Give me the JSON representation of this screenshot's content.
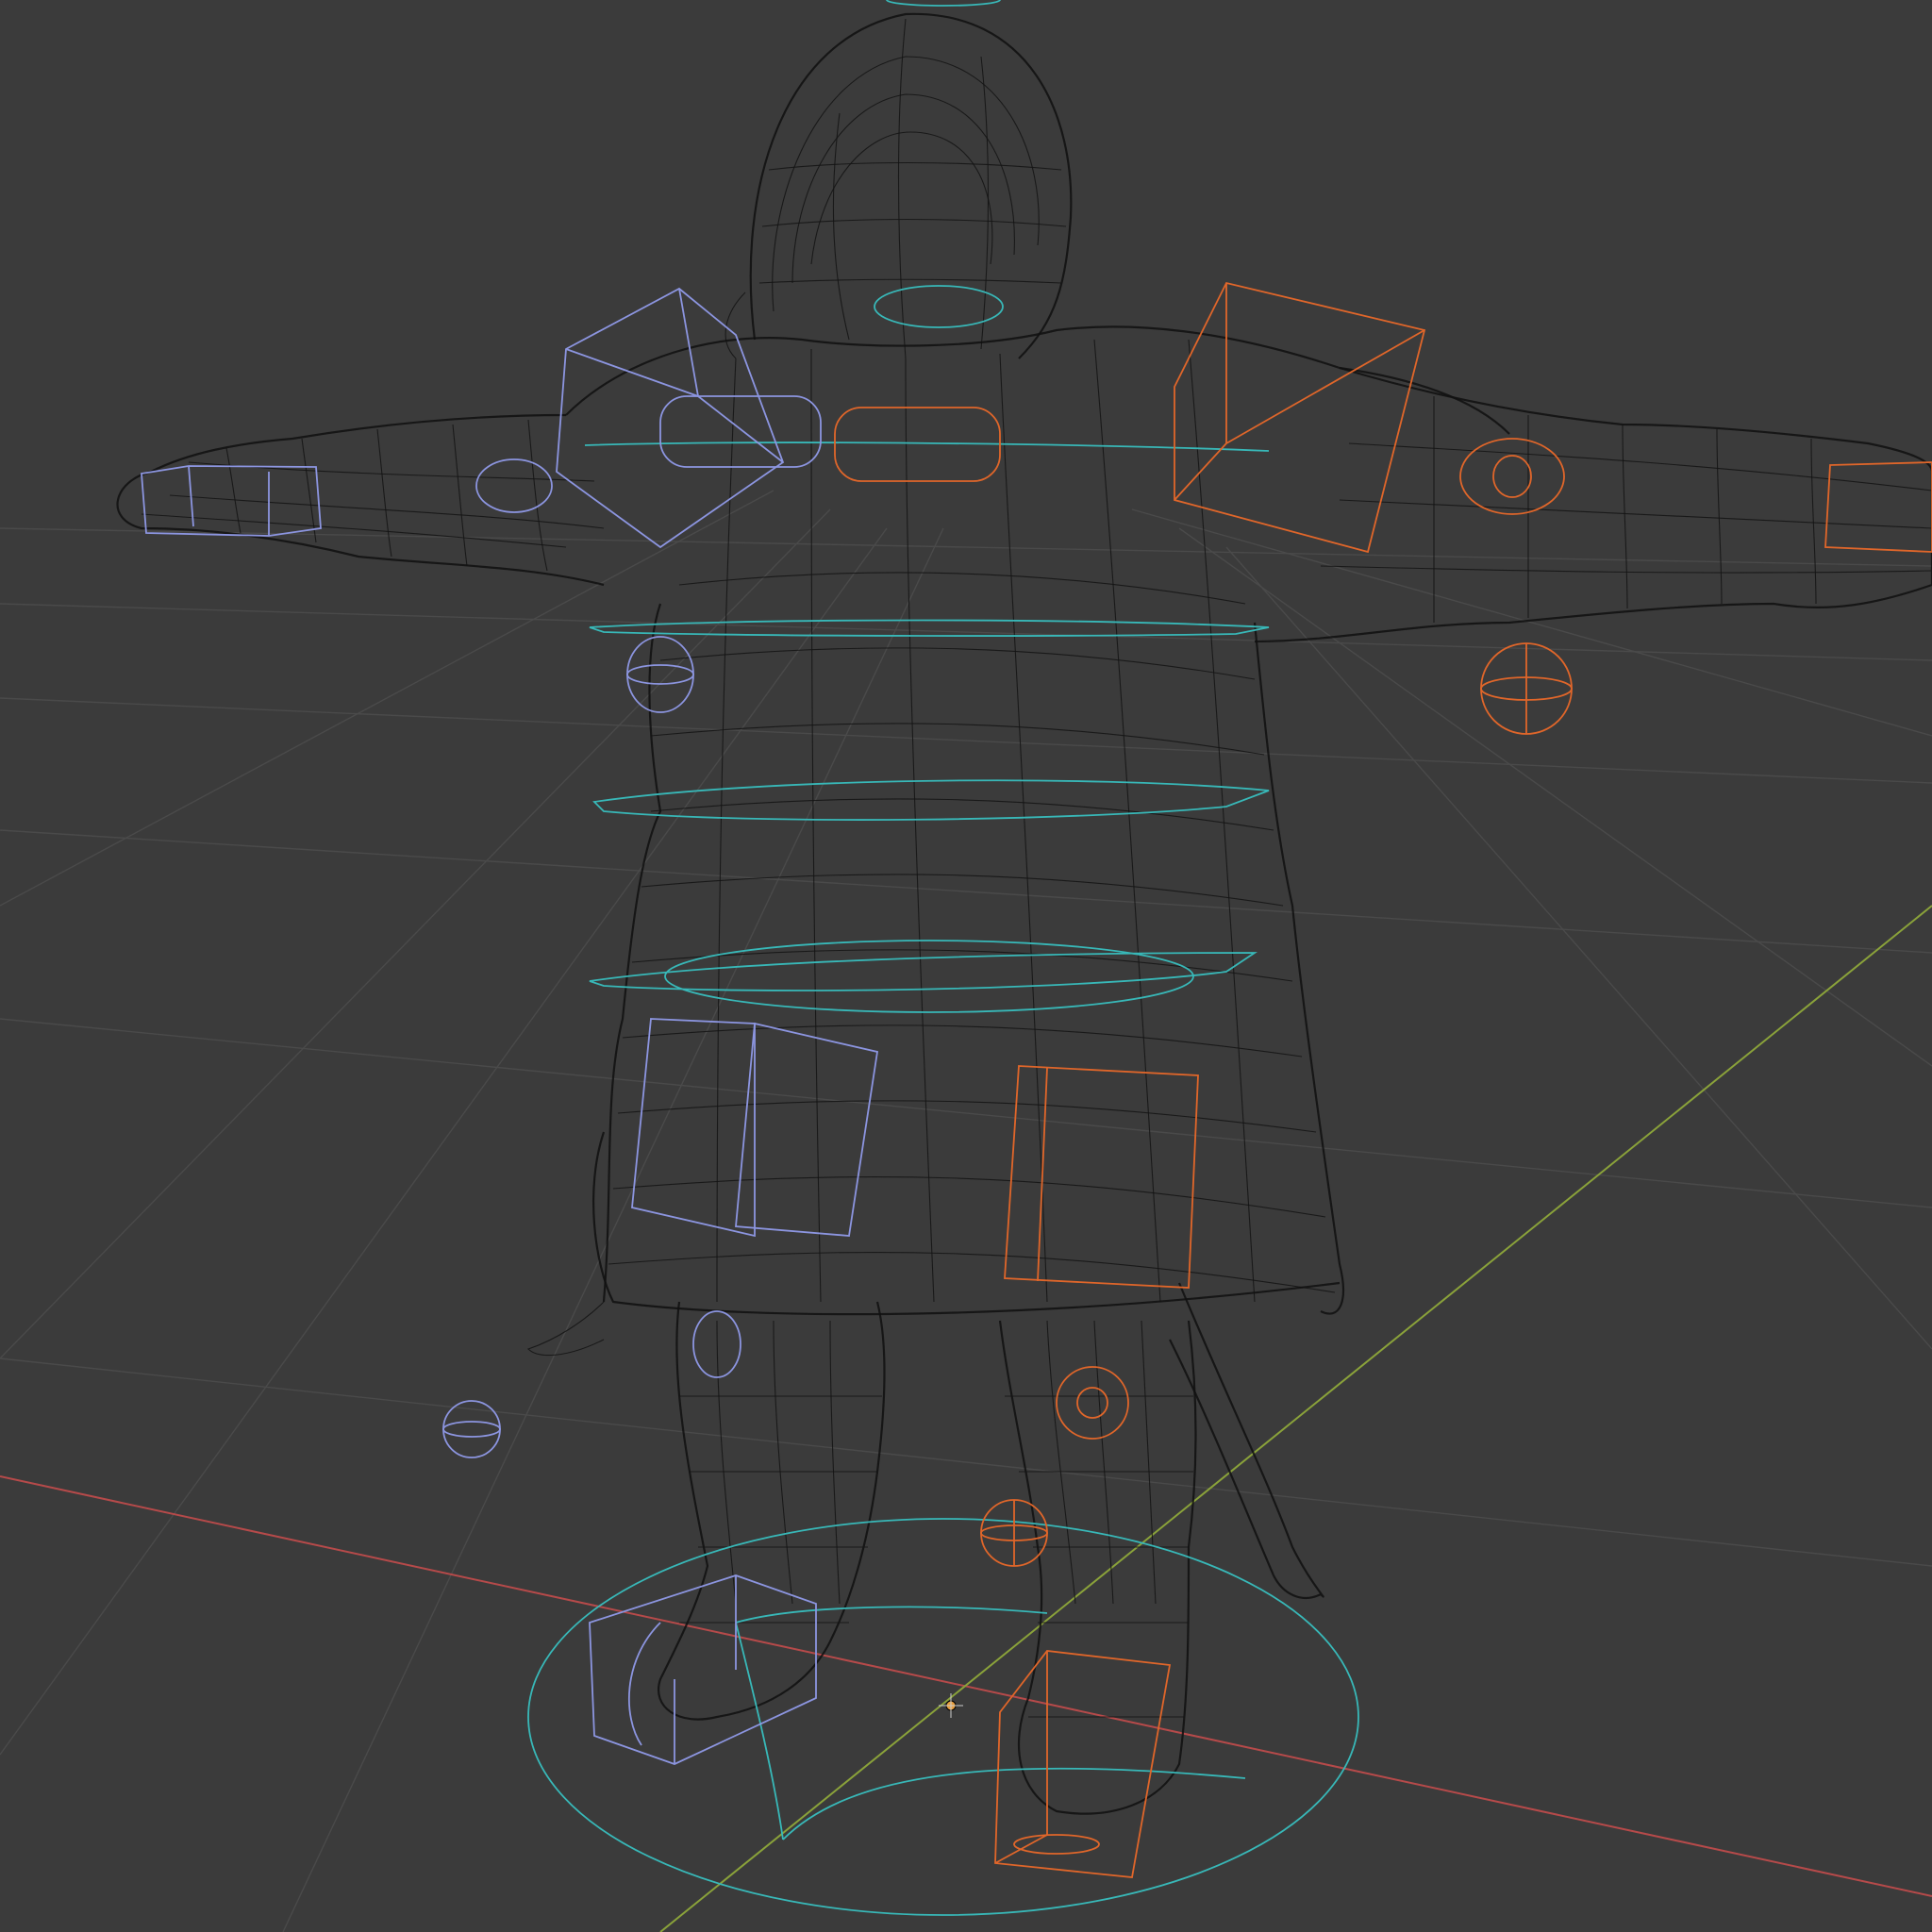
{
  "viewport": {
    "shading": "wireframe",
    "background_color": "#3b3b3b"
  },
  "colors": {
    "grid": "#4a4a4a",
    "axis_x": "#b64a4a",
    "axis_y": "#8aa23a",
    "mesh_wire": "#141414",
    "left_controls": "#8c95e0",
    "right_controls": "#e0662a",
    "center_controls": "#38b8b8",
    "origin": "#e8a040"
  },
  "scene": {
    "object": "rigged-character-mesh",
    "pose": "t-pose"
  }
}
